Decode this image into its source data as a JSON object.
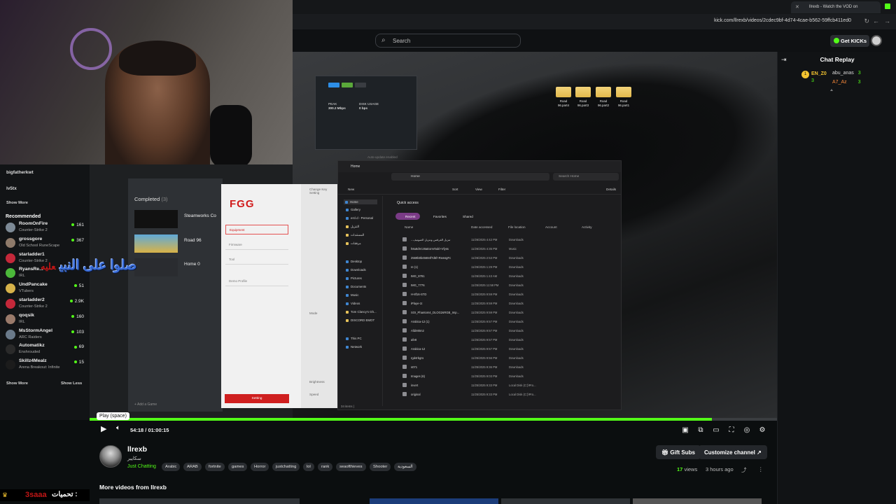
{
  "browser": {
    "tab_title": "llrexb - Watch the VOD on",
    "url": "kick.com/llrexb/videos/2cdec9bf-4d74-4cae-b562-59ffcb411ed0"
  },
  "header": {
    "search_placeholder": "Search",
    "get_kicks_label": "Get KICKs"
  },
  "stream": {
    "sidebar": {
      "top_names": [
        "bigfatherkwt",
        "lv5tx"
      ],
      "show_more": "Show More",
      "recommended_title": "Recommended",
      "items": [
        {
          "name": "RoomOnFire",
          "category": "Counter-Strike 2",
          "viewers": "161",
          "color": "#7d8a96"
        },
        {
          "name": "grossgore",
          "category": "Old School RuneScape",
          "viewers": "367",
          "color": "#8e7a6a"
        },
        {
          "name": "starladder1",
          "category": "Counter-Strike 2",
          "viewers": "",
          "color": "#c4283a"
        },
        {
          "name": "RyansRe...",
          "category": "IRL",
          "viewers": "",
          "color": "#4bb83a"
        },
        {
          "name": "UndPancake",
          "category": "VTubers",
          "viewers": "51",
          "color": "#d6b24a"
        },
        {
          "name": "starladder2",
          "category": "Counter-Strike 2",
          "viewers": "2.9K",
          "color": "#c4283a"
        },
        {
          "name": "qoqsik",
          "category": "IRL",
          "viewers": "160",
          "color": "#9a7a6a"
        },
        {
          "name": "MsStormAngel",
          "category": "ARC Raiders",
          "viewers": "103",
          "color": "#6a7a8a"
        },
        {
          "name": "Automatikz",
          "category": "Enshrouded",
          "viewers": "69",
          "color": "#2a2a2a"
        },
        {
          "name": "Skillz4Mealz",
          "category": "Arena Breakout: Infinite",
          "viewers": "15",
          "color": "#1c1c1c"
        }
      ],
      "show_more_bottom": "Show More",
      "show_less": "Show Less"
    },
    "launcher": {
      "completed": "Completed",
      "completed_count": "(3)",
      "games": [
        "Steamworks Co",
        "Road 96",
        "Home 0"
      ],
      "add_game": "+ Add a Game"
    },
    "fgg": {
      "logo": "FGG",
      "fields": [
        "Equipment",
        "Firmware",
        "Tool",
        "Demo Profile"
      ],
      "setting_button": "Setting",
      "side_labels": [
        "Change Key Setting",
        "Mode",
        "Brightness",
        "Speed"
      ]
    },
    "explorer": {
      "tab": "Home",
      "address": "Home",
      "search_placeholder": "Search Home",
      "toolbar": [
        "New",
        "Sort",
        "View",
        "Filter",
        "Details"
      ],
      "nav": [
        "Home",
        "Gallery",
        "ercl.d - Personal",
        "التنزيل",
        "المستندات",
        "مرفقات",
        "Desktop",
        "Downloads",
        "Pictures",
        "Documents",
        "Music",
        "Videos",
        "Tom Clancy's Gh...",
        "DISCORD EMOT",
        "This PC",
        "Network"
      ],
      "quick_access": "Quick access",
      "chips": [
        "Recent",
        "Favorites",
        "Shared"
      ],
      "columns": [
        "Name",
        "Date accessed",
        "File location",
        "Account",
        "Activity"
      ],
      "files": [
        {
          "name": "...تنزيل الفرقس وتنزيل الصوتيف",
          "date": "11/26/2025 4:42 PM",
          "loc": "Downloads"
        },
        {
          "name": "h8u8dVcz8aEonV0ukl+Vfyss",
          "date": "11/26/2025 4:35 PM",
          "loc": "Music"
        },
        {
          "name": "2569b0b45694f7d5f+RewsgFc",
          "date": "11/26/2025 2:53 PM",
          "loc": "Downloads"
        },
        {
          "name": "re (1)",
          "date": "11/26/2025 1:29 PM",
          "loc": "Downloads"
        },
        {
          "name": "IMG_8781",
          "date": "11/26/2025 1:43 AM",
          "loc": "Downloads"
        },
        {
          "name": "IMG_7776",
          "date": "11/25/2025 11:58 PM",
          "loc": "Downloads"
        },
        {
          "name": "H-8f16-STD",
          "date": "11/25/2025 9:59 PM",
          "loc": "Downloads"
        },
        {
          "name": "iPlaye-1t",
          "date": "11/25/2025 9:59 PM",
          "loc": "Downloads"
        },
        {
          "name": "SOI_Phantom4_DLOG2sRGB_Imp...",
          "date": "11/25/2025 9:59 PM",
          "loc": "Downloads"
        },
        {
          "name": "Arabica-12 (1)",
          "date": "11/25/2025 9:57 PM",
          "loc": "Downloads"
        },
        {
          "name": "AfdiM0m2",
          "date": "11/25/2025 9:57 PM",
          "loc": "Downloads"
        },
        {
          "name": "afe8",
          "date": "11/25/2025 9:57 PM",
          "loc": "Downloads"
        },
        {
          "name": "Arabica-12",
          "date": "11/25/2025 9:57 PM",
          "loc": "Downloads"
        },
        {
          "name": "rgd4rbgro",
          "date": "11/25/2025 9:56 PM",
          "loc": "Downloads"
        },
        {
          "name": "s071",
          "date": "11/25/2025 9:36 PM",
          "loc": "Downloads"
        },
        {
          "name": "Images (6)",
          "date": "11/25/2025 9:03 PM",
          "loc": "Downloads"
        },
        {
          "name": "invert",
          "date": "11/25/2025 9:33 PM",
          "loc": "Local Disk (C:)\\Pro..."
        },
        {
          "name": "original",
          "date": "11/25/2025 9:33 PM",
          "loc": "Local Disk (C:)\\Pro..."
        }
      ],
      "status": "34 items  |"
    },
    "widget": {
      "peak_label": "PEAK",
      "peak_value": "300.2 Mbps",
      "disk_label": "DISK USAGE",
      "disk_value": "0 bps",
      "auto_update": "Auto-update enabled"
    },
    "desktop_folders": [
      "Road 96.part4",
      "Road 96.part3",
      "Road 96.part2",
      "Road 96.part1"
    ],
    "overlay_text": "صلوا على النبي",
    "overlay_red": "عليه"
  },
  "player": {
    "tooltip": "Play (space)",
    "current_time": "54:18",
    "duration": "01:00:15",
    "progress_fraction": 0.905
  },
  "chat": {
    "title": "Chat Replay",
    "gifters": [
      {
        "rank": "1",
        "name": "EN_Z0",
        "count": "3"
      },
      {
        "name": "abu_anas",
        "count": "3"
      },
      {
        "name": "A7_Az",
        "count": "3"
      }
    ],
    "extra_count": "3"
  },
  "channel": {
    "name": "llrexb",
    "subtitle": "سكايير",
    "category": "Just Chatting",
    "tags": [
      "Arabic",
      "ARAB",
      "fortnite",
      "games",
      "Horror",
      "justchatting",
      "lol",
      "rank",
      "seaofthieves",
      "Shooter",
      "السعودية"
    ],
    "gift_subs": "Gift Subs",
    "customize": "Customize channel",
    "views_count": "17",
    "views_label": "views",
    "posted": "3 hours ago",
    "more_videos": "More videos from llrexb"
  },
  "ticker": {
    "name": "3saaa",
    "label": "تحميات :"
  },
  "colors": {
    "kick_green": "#53fc18",
    "fgg_red": "#d11b1b",
    "recent_chip": "#7a3b86"
  }
}
